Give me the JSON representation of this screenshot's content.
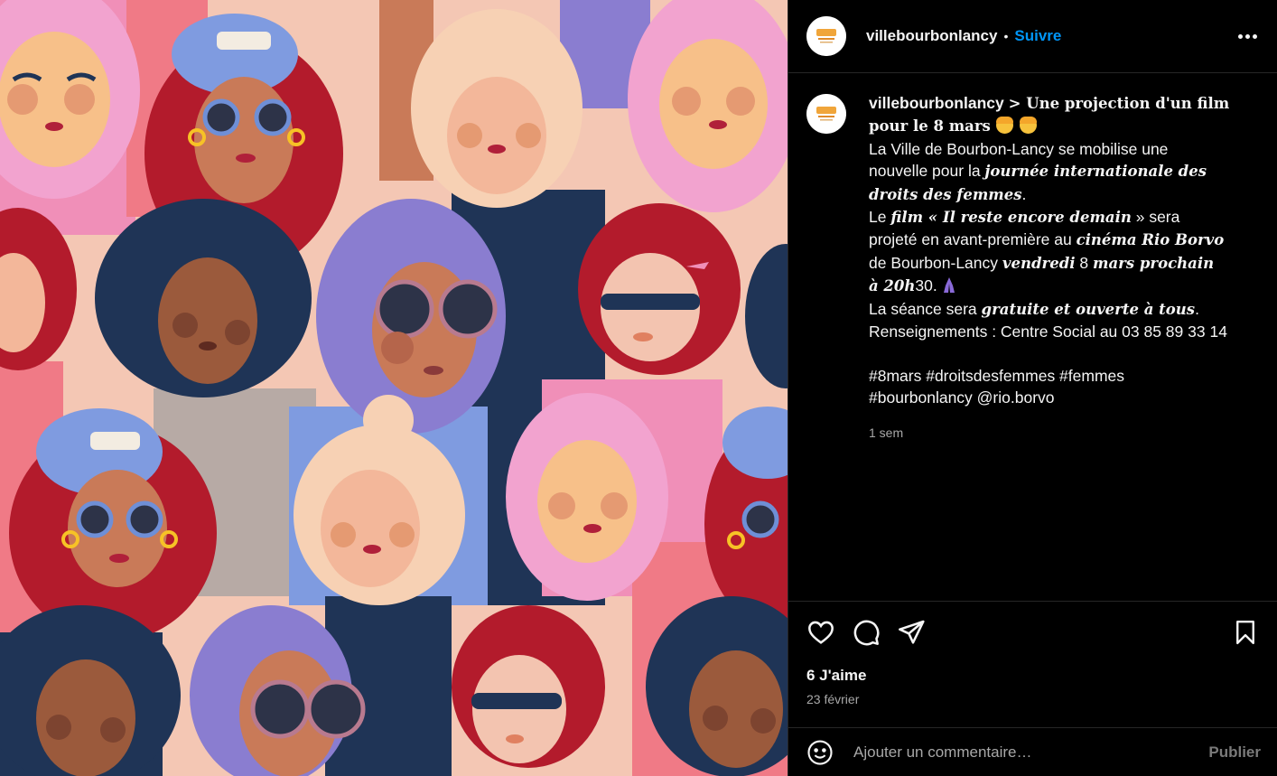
{
  "post": {
    "username": "villebourbonlancy",
    "follow_label": "Suivre",
    "separator": "•",
    "logo_text": "BOURBON-LANCY",
    "image_alt": "Illustration de femmes"
  },
  "caption": {
    "username": "villebourbonlancy",
    "title_a": "> Une projection d'un film",
    "title_b": "pour le 8 mars",
    "l1": "La Ville de Bourbon-Lancy se mobilise une",
    "l2a": "nouvelle pour la ",
    "l2b": "journée internationale des",
    "l3": "droits des femmes",
    "l3end": ".",
    "l4a": "Le ",
    "l4b": "film « Il reste encore demain",
    "l4c": " » sera",
    "l5a": "projeté en avant-première au ",
    "l5b": "cinéma Rio Borvo",
    "l6a": "de Bourbon-Lancy ",
    "l6b": "vendredi",
    "l6c": " 8 ",
    "l6d": "mars prochain",
    "l7a": "à 20",
    "l7b": "h",
    "l7c": "30. ",
    "l8a": "La séance sera ",
    "l8b": "gratuite et ouverte à tous",
    "l8c": ".",
    "l9": "Renseignements : Centre Social au 03 85 89 33 14",
    "tags1": "#8mars #droitsdesfemmes #femmes",
    "tags2": "#bourbonlancy @rio.borvo",
    "time": "1 sem"
  },
  "actions": {
    "icons": [
      "heart-icon",
      "comment-icon",
      "share-icon",
      "bookmark-icon"
    ],
    "likes": "6 J'aime",
    "date": "23 février"
  },
  "comment": {
    "placeholder": "Ajouter un commentaire…",
    "publish_label": "Publier"
  },
  "colors": {
    "background": "#000000",
    "link": "#0095f6",
    "muted": "#a8a8a8",
    "border": "#262626"
  }
}
